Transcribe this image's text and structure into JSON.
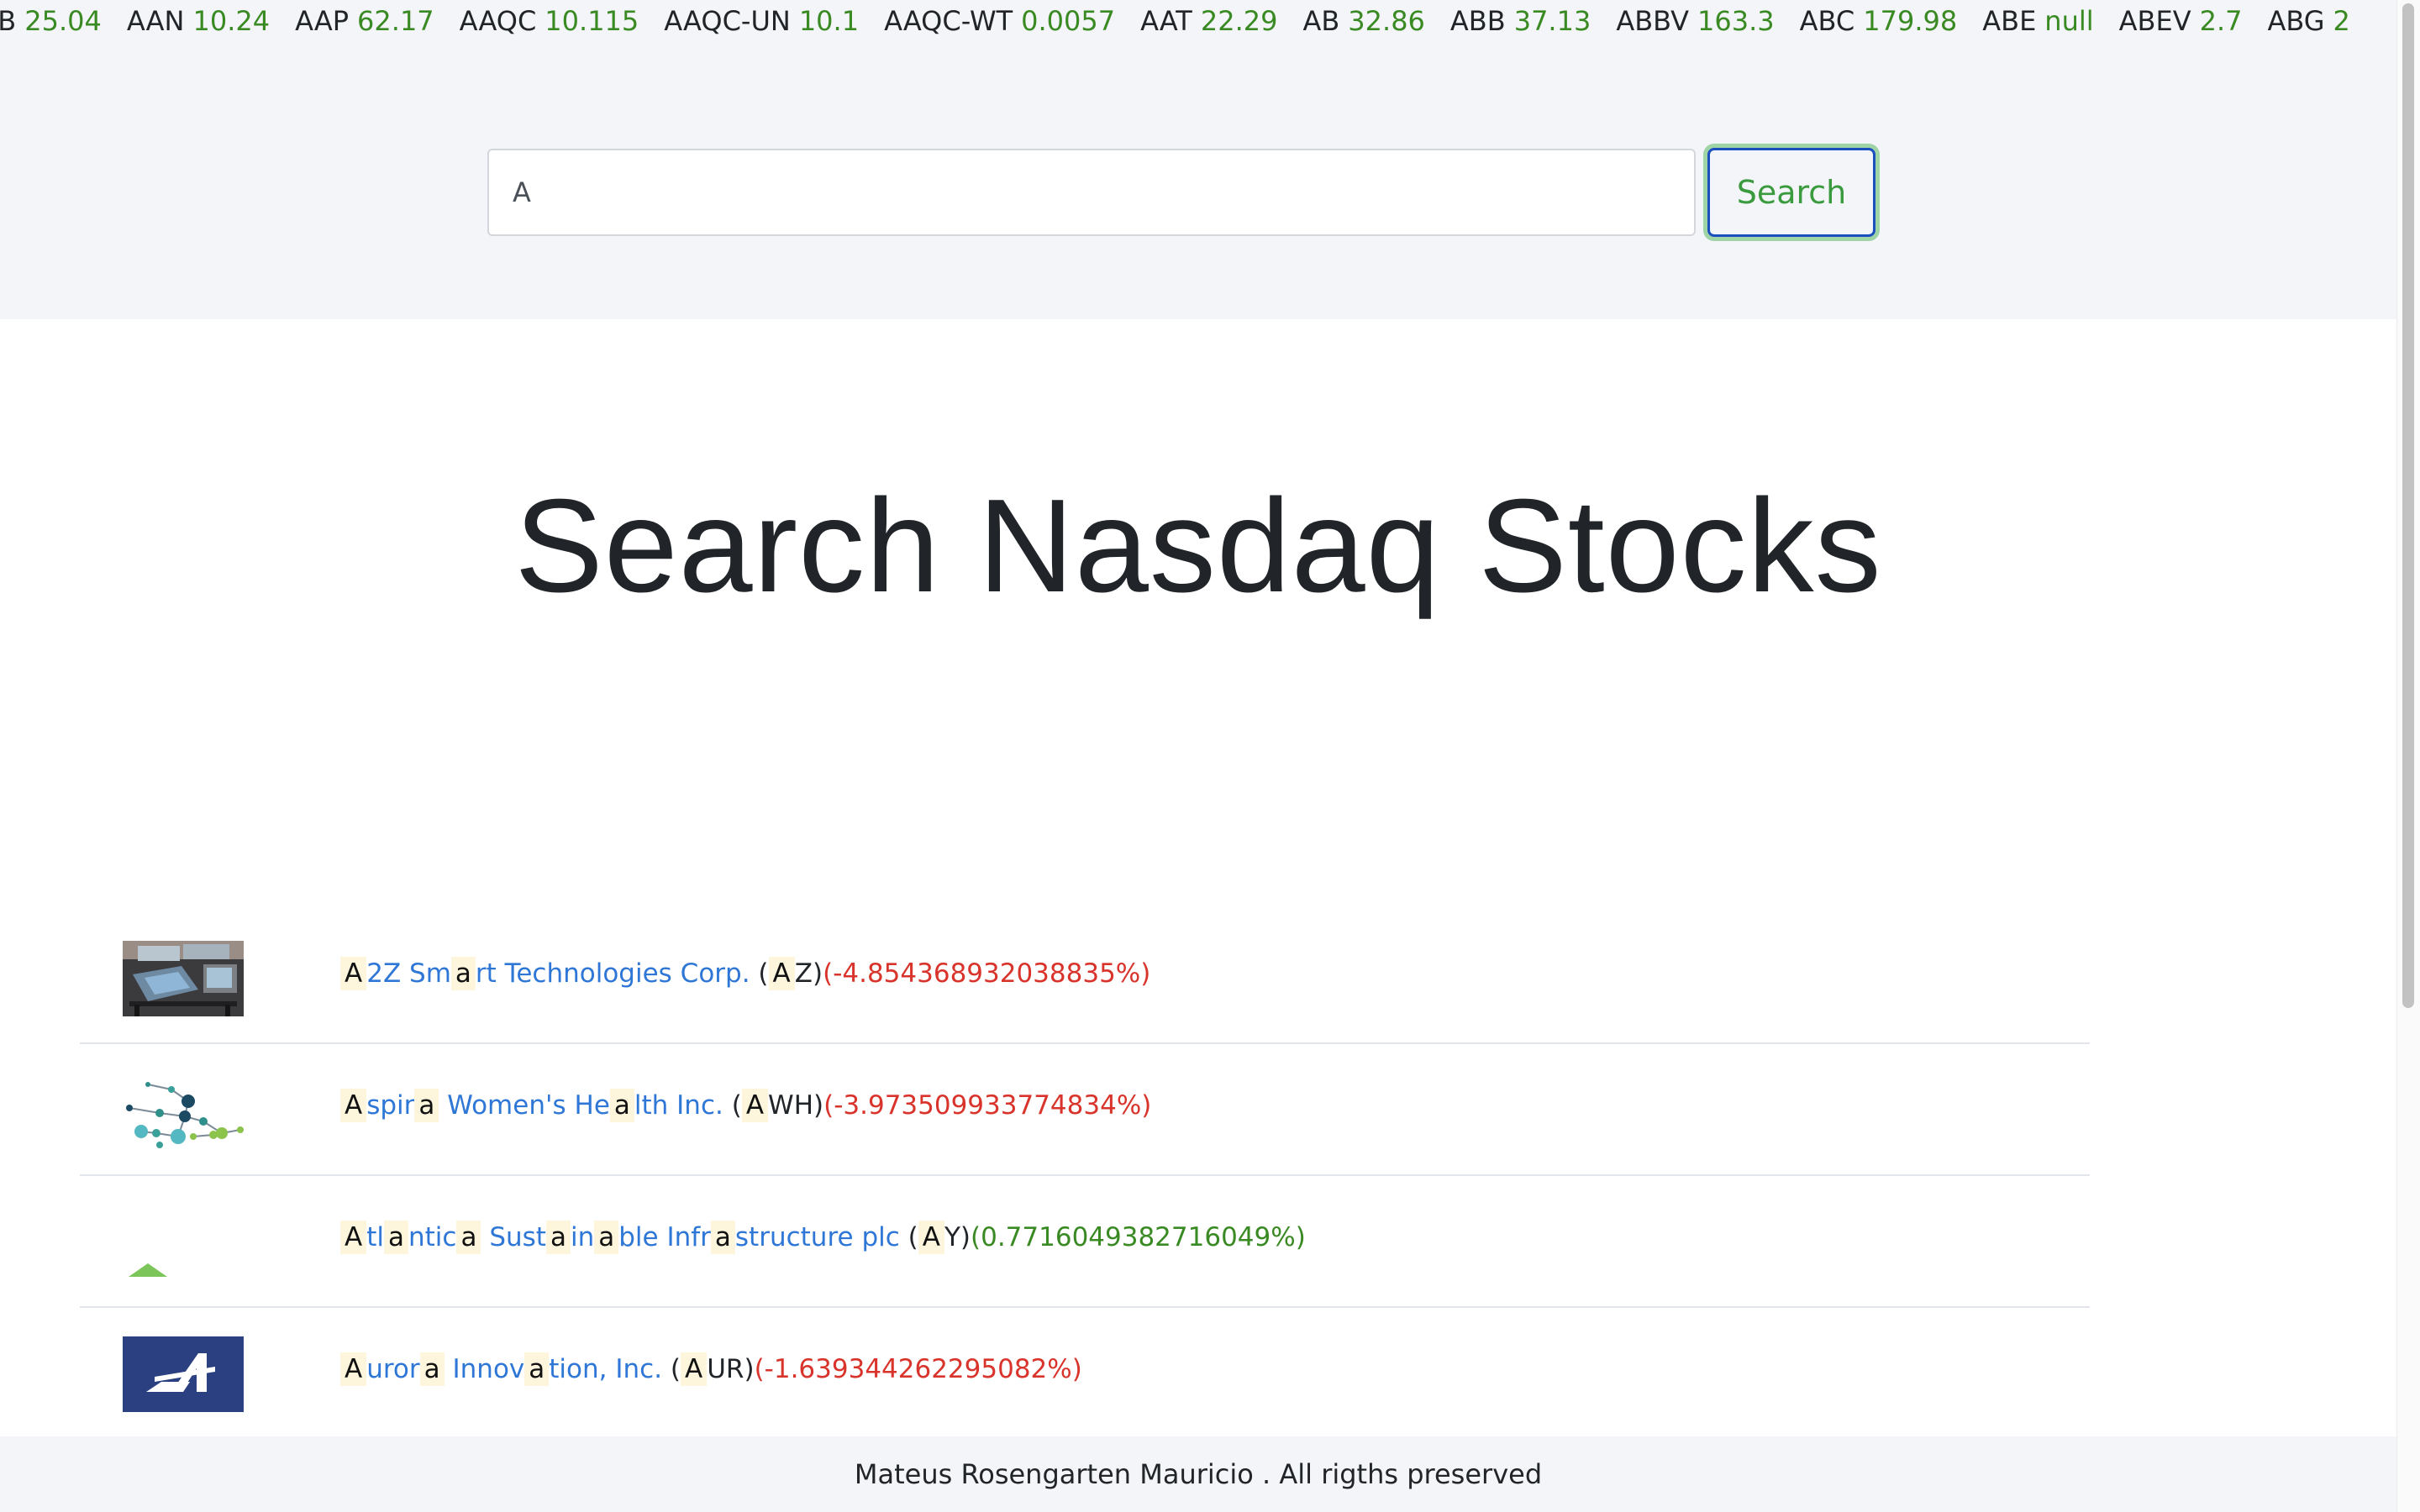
{
  "ticker": {
    "items": [
      {
        "symbol": "PB",
        "value": "25.04"
      },
      {
        "symbol": "AAN",
        "value": "10.24"
      },
      {
        "symbol": "AAP",
        "value": "62.17"
      },
      {
        "symbol": "AAQC",
        "value": "10.115"
      },
      {
        "symbol": "AAQC-UN",
        "value": "10.1"
      },
      {
        "symbol": "AAQC-WT",
        "value": "0.0057"
      },
      {
        "symbol": "AAT",
        "value": "22.29"
      },
      {
        "symbol": "AB",
        "value": "32.86"
      },
      {
        "symbol": "ABB",
        "value": "37.13"
      },
      {
        "symbol": "ABBV",
        "value": "163.3"
      },
      {
        "symbol": "ABC",
        "value": "179.98"
      },
      {
        "symbol": "ABE",
        "value": "null"
      },
      {
        "symbol": "ABEV",
        "value": "2.7"
      },
      {
        "symbol": "ABG",
        "value": "2"
      }
    ],
    "value_color": "#3a8a24"
  },
  "search": {
    "value": "A",
    "button_label": "Search"
  },
  "page_title": "Search Nasdaq Stocks",
  "results": [
    {
      "logo_icon": "display-tables-photo-icon",
      "name_parts": [
        {
          "text": "A",
          "hl": true
        },
        {
          "text": "2Z Sm",
          "hl": false
        },
        {
          "text": "a",
          "hl": true
        },
        {
          "text": "rt Technologies Corp.",
          "hl": false
        }
      ],
      "ticker_parts": [
        {
          "text": "(",
          "hl": false
        },
        {
          "text": "A",
          "hl": true
        },
        {
          "text": "Z)",
          "hl": false
        }
      ],
      "change": "(-4.854368932038835%)",
      "direction": "down"
    },
    {
      "logo_icon": "molecule-network-icon",
      "name_parts": [
        {
          "text": "A",
          "hl": true
        },
        {
          "text": "spir",
          "hl": false
        },
        {
          "text": "a",
          "hl": true
        },
        {
          "text": " Women's He",
          "hl": false
        },
        {
          "text": "a",
          "hl": true
        },
        {
          "text": "lth Inc.",
          "hl": false
        }
      ],
      "ticker_parts": [
        {
          "text": "(",
          "hl": false
        },
        {
          "text": "A",
          "hl": true
        },
        {
          "text": "WH)",
          "hl": false
        }
      ],
      "change": "(-3.973509933774834%)",
      "direction": "down"
    },
    {
      "logo_icon": "green-triangle-logo-icon",
      "name_parts": [
        {
          "text": "A",
          "hl": true
        },
        {
          "text": "tl",
          "hl": false
        },
        {
          "text": "a",
          "hl": true
        },
        {
          "text": "ntic",
          "hl": false
        },
        {
          "text": "a",
          "hl": true
        },
        {
          "text": " Sust",
          "hl": false
        },
        {
          "text": "a",
          "hl": true
        },
        {
          "text": "in",
          "hl": false
        },
        {
          "text": "a",
          "hl": true
        },
        {
          "text": "ble Infr",
          "hl": false
        },
        {
          "text": "a",
          "hl": true
        },
        {
          "text": "structure plc",
          "hl": false
        }
      ],
      "ticker_parts": [
        {
          "text": "(",
          "hl": false
        },
        {
          "text": "A",
          "hl": true
        },
        {
          "text": "Y)",
          "hl": false
        }
      ],
      "change": "(0.7716049382716049%)",
      "direction": "up"
    },
    {
      "logo_icon": "aurora-a-logo-icon",
      "name_parts": [
        {
          "text": "A",
          "hl": true
        },
        {
          "text": "uror",
          "hl": false
        },
        {
          "text": "a",
          "hl": true
        },
        {
          "text": " Innov",
          "hl": false
        },
        {
          "text": "a",
          "hl": true
        },
        {
          "text": "tion, Inc.",
          "hl": false
        }
      ],
      "ticker_parts": [
        {
          "text": "(",
          "hl": false
        },
        {
          "text": "A",
          "hl": true
        },
        {
          "text": "UR)",
          "hl": false
        }
      ],
      "change": "(-1.639344262295082%)",
      "direction": "down"
    }
  ],
  "colors": {
    "negative": "#d9342b",
    "positive": "#3a8a24",
    "link": "#2f77d6",
    "highlight": "#fdf6dd"
  },
  "footer": {
    "text": "Mateus Rosengarten Mauricio . All rigths preserved"
  }
}
